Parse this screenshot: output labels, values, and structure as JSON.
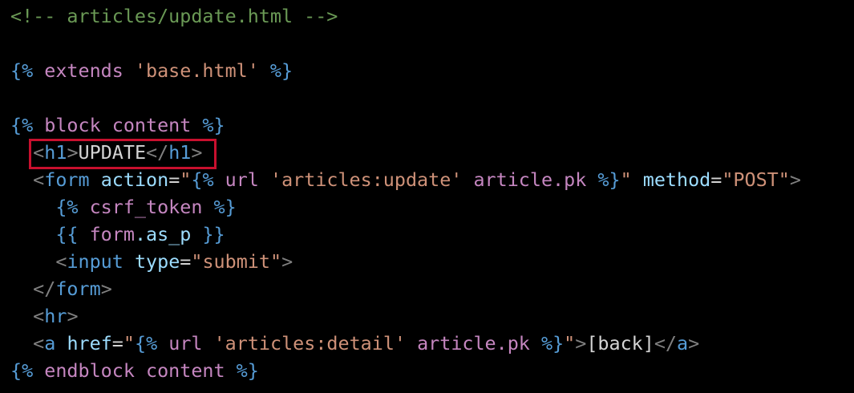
{
  "colors": {
    "comment": "#6a9955",
    "delim": "#569cd6",
    "keyword": "#c586c0",
    "string": "#ce9178",
    "variable": "#9cdcfe",
    "tag": "#569cd6",
    "bracket": "#808080",
    "attr": "#9cdcfe",
    "text": "#d4d4d4",
    "highlight_border": "#c8102e"
  },
  "lines": [
    [
      {
        "t": "<!-- articles/update.html -->",
        "c": "comment"
      }
    ],
    [],
    [
      {
        "t": "{%",
        "c": "delim"
      },
      {
        "t": " extends ",
        "c": "keyword"
      },
      {
        "t": "'base.html'",
        "c": "string"
      },
      {
        "t": " %}",
        "c": "delim"
      }
    ],
    [],
    [
      {
        "t": "{%",
        "c": "delim"
      },
      {
        "t": " block content ",
        "c": "keyword"
      },
      {
        "t": "%}",
        "c": "delim"
      }
    ],
    [
      {
        "t": "  ",
        "c": "text"
      },
      {
        "t": "<",
        "c": "bracket"
      },
      {
        "t": "h1",
        "c": "tag"
      },
      {
        "t": ">",
        "c": "bracket"
      },
      {
        "t": "UPDATE",
        "c": "text"
      },
      {
        "t": "</",
        "c": "bracket"
      },
      {
        "t": "h1",
        "c": "tag"
      },
      {
        "t": ">",
        "c": "bracket"
      }
    ],
    [
      {
        "t": "  ",
        "c": "text"
      },
      {
        "t": "<",
        "c": "bracket"
      },
      {
        "t": "form",
        "c": "tag"
      },
      {
        "t": " ",
        "c": "text"
      },
      {
        "t": "action",
        "c": "attr"
      },
      {
        "t": "=",
        "c": "text"
      },
      {
        "t": "\"",
        "c": "string"
      },
      {
        "t": "{%",
        "c": "delim"
      },
      {
        "t": " url ",
        "c": "keyword"
      },
      {
        "t": "'articles:update'",
        "c": "string"
      },
      {
        "t": " article.pk ",
        "c": "keyword"
      },
      {
        "t": "%}",
        "c": "delim"
      },
      {
        "t": "\"",
        "c": "string"
      },
      {
        "t": " ",
        "c": "text"
      },
      {
        "t": "method",
        "c": "attr"
      },
      {
        "t": "=",
        "c": "text"
      },
      {
        "t": "\"POST\"",
        "c": "string"
      },
      {
        "t": ">",
        "c": "bracket"
      }
    ],
    [
      {
        "t": "    ",
        "c": "text"
      },
      {
        "t": "{%",
        "c": "delim"
      },
      {
        "t": " csrf_token ",
        "c": "keyword"
      },
      {
        "t": "%}",
        "c": "delim"
      }
    ],
    [
      {
        "t": "    ",
        "c": "text"
      },
      {
        "t": "{{",
        "c": "delim"
      },
      {
        "t": " form",
        "c": "keyword"
      },
      {
        "t": ".as_p ",
        "c": "variable"
      },
      {
        "t": "}}",
        "c": "delim"
      }
    ],
    [
      {
        "t": "    ",
        "c": "text"
      },
      {
        "t": "<",
        "c": "bracket"
      },
      {
        "t": "input",
        "c": "tag"
      },
      {
        "t": " ",
        "c": "text"
      },
      {
        "t": "type",
        "c": "attr"
      },
      {
        "t": "=",
        "c": "text"
      },
      {
        "t": "\"submit\"",
        "c": "string"
      },
      {
        "t": ">",
        "c": "bracket"
      }
    ],
    [
      {
        "t": "  ",
        "c": "text"
      },
      {
        "t": "</",
        "c": "bracket"
      },
      {
        "t": "form",
        "c": "tag"
      },
      {
        "t": ">",
        "c": "bracket"
      }
    ],
    [
      {
        "t": "  ",
        "c": "text"
      },
      {
        "t": "<",
        "c": "bracket"
      },
      {
        "t": "hr",
        "c": "tag"
      },
      {
        "t": ">",
        "c": "bracket"
      }
    ],
    [
      {
        "t": "  ",
        "c": "text"
      },
      {
        "t": "<",
        "c": "bracket"
      },
      {
        "t": "a",
        "c": "tag"
      },
      {
        "t": " ",
        "c": "text"
      },
      {
        "t": "href",
        "c": "attr"
      },
      {
        "t": "=",
        "c": "text"
      },
      {
        "t": "\"",
        "c": "string"
      },
      {
        "t": "{%",
        "c": "delim"
      },
      {
        "t": " url ",
        "c": "keyword"
      },
      {
        "t": "'articles:detail'",
        "c": "string"
      },
      {
        "t": " article.pk ",
        "c": "keyword"
      },
      {
        "t": "%}",
        "c": "delim"
      },
      {
        "t": "\"",
        "c": "string"
      },
      {
        "t": ">",
        "c": "bracket"
      },
      {
        "t": "[back]",
        "c": "text"
      },
      {
        "t": "</",
        "c": "bracket"
      },
      {
        "t": "a",
        "c": "tag"
      },
      {
        "t": ">",
        "c": "bracket"
      }
    ],
    [
      {
        "t": "{%",
        "c": "delim"
      },
      {
        "t": " endblock content ",
        "c": "keyword"
      },
      {
        "t": "%}",
        "c": "delim"
      }
    ]
  ]
}
